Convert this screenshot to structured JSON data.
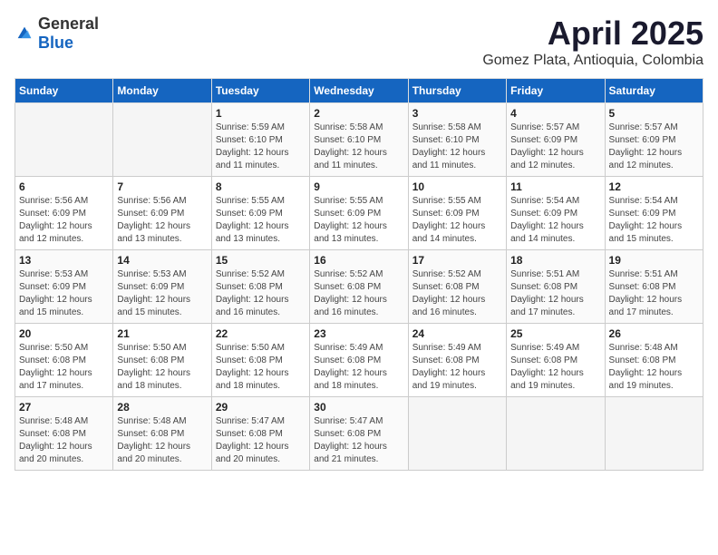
{
  "logo": {
    "general": "General",
    "blue": "Blue"
  },
  "title": "April 2025",
  "subtitle": "Gomez Plata, Antioquia, Colombia",
  "weekdays": [
    "Sunday",
    "Monday",
    "Tuesday",
    "Wednesday",
    "Thursday",
    "Friday",
    "Saturday"
  ],
  "weeks": [
    [
      {
        "day": "",
        "info": ""
      },
      {
        "day": "",
        "info": ""
      },
      {
        "day": "1",
        "info": "Sunrise: 5:59 AM\nSunset: 6:10 PM\nDaylight: 12 hours\nand 11 minutes."
      },
      {
        "day": "2",
        "info": "Sunrise: 5:58 AM\nSunset: 6:10 PM\nDaylight: 12 hours\nand 11 minutes."
      },
      {
        "day": "3",
        "info": "Sunrise: 5:58 AM\nSunset: 6:10 PM\nDaylight: 12 hours\nand 11 minutes."
      },
      {
        "day": "4",
        "info": "Sunrise: 5:57 AM\nSunset: 6:09 PM\nDaylight: 12 hours\nand 12 minutes."
      },
      {
        "day": "5",
        "info": "Sunrise: 5:57 AM\nSunset: 6:09 PM\nDaylight: 12 hours\nand 12 minutes."
      }
    ],
    [
      {
        "day": "6",
        "info": "Sunrise: 5:56 AM\nSunset: 6:09 PM\nDaylight: 12 hours\nand 12 minutes."
      },
      {
        "day": "7",
        "info": "Sunrise: 5:56 AM\nSunset: 6:09 PM\nDaylight: 12 hours\nand 13 minutes."
      },
      {
        "day": "8",
        "info": "Sunrise: 5:55 AM\nSunset: 6:09 PM\nDaylight: 12 hours\nand 13 minutes."
      },
      {
        "day": "9",
        "info": "Sunrise: 5:55 AM\nSunset: 6:09 PM\nDaylight: 12 hours\nand 13 minutes."
      },
      {
        "day": "10",
        "info": "Sunrise: 5:55 AM\nSunset: 6:09 PM\nDaylight: 12 hours\nand 14 minutes."
      },
      {
        "day": "11",
        "info": "Sunrise: 5:54 AM\nSunset: 6:09 PM\nDaylight: 12 hours\nand 14 minutes."
      },
      {
        "day": "12",
        "info": "Sunrise: 5:54 AM\nSunset: 6:09 PM\nDaylight: 12 hours\nand 15 minutes."
      }
    ],
    [
      {
        "day": "13",
        "info": "Sunrise: 5:53 AM\nSunset: 6:09 PM\nDaylight: 12 hours\nand 15 minutes."
      },
      {
        "day": "14",
        "info": "Sunrise: 5:53 AM\nSunset: 6:09 PM\nDaylight: 12 hours\nand 15 minutes."
      },
      {
        "day": "15",
        "info": "Sunrise: 5:52 AM\nSunset: 6:08 PM\nDaylight: 12 hours\nand 16 minutes."
      },
      {
        "day": "16",
        "info": "Sunrise: 5:52 AM\nSunset: 6:08 PM\nDaylight: 12 hours\nand 16 minutes."
      },
      {
        "day": "17",
        "info": "Sunrise: 5:52 AM\nSunset: 6:08 PM\nDaylight: 12 hours\nand 16 minutes."
      },
      {
        "day": "18",
        "info": "Sunrise: 5:51 AM\nSunset: 6:08 PM\nDaylight: 12 hours\nand 17 minutes."
      },
      {
        "day": "19",
        "info": "Sunrise: 5:51 AM\nSunset: 6:08 PM\nDaylight: 12 hours\nand 17 minutes."
      }
    ],
    [
      {
        "day": "20",
        "info": "Sunrise: 5:50 AM\nSunset: 6:08 PM\nDaylight: 12 hours\nand 17 minutes."
      },
      {
        "day": "21",
        "info": "Sunrise: 5:50 AM\nSunset: 6:08 PM\nDaylight: 12 hours\nand 18 minutes."
      },
      {
        "day": "22",
        "info": "Sunrise: 5:50 AM\nSunset: 6:08 PM\nDaylight: 12 hours\nand 18 minutes."
      },
      {
        "day": "23",
        "info": "Sunrise: 5:49 AM\nSunset: 6:08 PM\nDaylight: 12 hours\nand 18 minutes."
      },
      {
        "day": "24",
        "info": "Sunrise: 5:49 AM\nSunset: 6:08 PM\nDaylight: 12 hours\nand 19 minutes."
      },
      {
        "day": "25",
        "info": "Sunrise: 5:49 AM\nSunset: 6:08 PM\nDaylight: 12 hours\nand 19 minutes."
      },
      {
        "day": "26",
        "info": "Sunrise: 5:48 AM\nSunset: 6:08 PM\nDaylight: 12 hours\nand 19 minutes."
      }
    ],
    [
      {
        "day": "27",
        "info": "Sunrise: 5:48 AM\nSunset: 6:08 PM\nDaylight: 12 hours\nand 20 minutes."
      },
      {
        "day": "28",
        "info": "Sunrise: 5:48 AM\nSunset: 6:08 PM\nDaylight: 12 hours\nand 20 minutes."
      },
      {
        "day": "29",
        "info": "Sunrise: 5:47 AM\nSunset: 6:08 PM\nDaylight: 12 hours\nand 20 minutes."
      },
      {
        "day": "30",
        "info": "Sunrise: 5:47 AM\nSunset: 6:08 PM\nDaylight: 12 hours\nand 21 minutes."
      },
      {
        "day": "",
        "info": ""
      },
      {
        "day": "",
        "info": ""
      },
      {
        "day": "",
        "info": ""
      }
    ]
  ]
}
